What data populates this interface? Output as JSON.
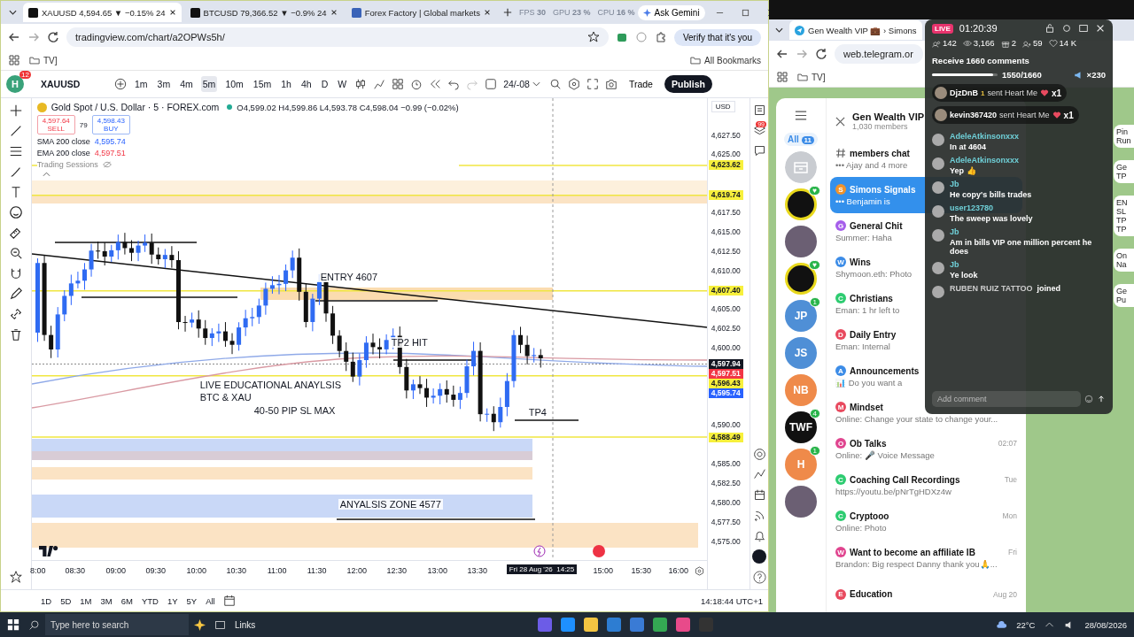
{
  "left_browser": {
    "tabs": [
      {
        "title": "XAUUSD 4,594.65 ▼ −0.15% 24",
        "selected": true
      },
      {
        "title": "BTCUSD 79,366.52 ▼ −0.9% 24",
        "selected": false
      },
      {
        "title": "Forex Factory | Global markets",
        "selected": false
      }
    ],
    "perf": [
      {
        "label": "FPS",
        "value": "30"
      },
      {
        "label": "GPU",
        "value": "23 %"
      },
      {
        "label": "CPU",
        "value": "16 %"
      }
    ],
    "ask": "Ask Gemini",
    "url": "tradingview.com/chart/a2OPWs5h/",
    "verify": "Verify that it's you",
    "bookmark_folder": "TV]",
    "all_bookmarks": "All Bookmarks"
  },
  "tv_toolbar": {
    "avatar": "H",
    "notifications": "12",
    "symbol": "XAUUSD",
    "intervals": [
      {
        "label": "1m",
        "selected": false
      },
      {
        "label": "3m",
        "selected": false
      },
      {
        "label": "4m",
        "selected": false
      },
      {
        "label": "5m",
        "selected": true
      },
      {
        "label": "10m",
        "selected": false
      },
      {
        "label": "15m",
        "selected": false
      },
      {
        "label": "1h",
        "selected": false
      },
      {
        "label": "4h",
        "selected": false
      },
      {
        "label": "D",
        "selected": false
      },
      {
        "label": "W",
        "selected": false
      }
    ],
    "date_range": "24/-08",
    "trade": "Trade",
    "publish": "Publish",
    "alerts_badge": "99"
  },
  "legend": {
    "title": "Gold Spot / U.S. Dollar · 5 · FOREX.com",
    "ohlc": "O4,599.02 H4,599.86 L4,593.78 C4,598.04 −0.99 (−0.02%)",
    "sell_price": "4,597.64",
    "sell": "SELL",
    "spread": "79",
    "buy_price": "4,598.43",
    "buy": "BUY",
    "indicators": [
      {
        "name": "SMA 200 close",
        "value": "4,595.74"
      },
      {
        "name": "EMA 200 close",
        "value": "4,597.51"
      }
    ],
    "sessions": "Trading Sessions"
  },
  "currency": "USD",
  "annotations": [
    "ENTRY 4607",
    "TP2 HIT",
    "LIVE EDUCATIONAL ANAYLSIS",
    "BTC & XAU",
    "40-50 PIP SL MAX",
    "TP4",
    "ANYALSIS ZONE 4577"
  ],
  "price_axis": [
    {
      "label": "4,627.50",
      "kind": "tick"
    },
    {
      "label": "4,625.00",
      "kind": "tick"
    },
    {
      "label": "4,623.62",
      "kind": "tag",
      "color": "#f7f03c"
    },
    {
      "label": "4,619.74",
      "kind": "tag",
      "color": "#f7f03c"
    },
    {
      "label": "4,617.50",
      "kind": "tick"
    },
    {
      "label": "4,615.00",
      "kind": "tick"
    },
    {
      "label": "4,612.50",
      "kind": "tick"
    },
    {
      "label": "4,610.00",
      "kind": "tick"
    },
    {
      "label": "4,607.40",
      "kind": "tag",
      "color": "#f7f03c"
    },
    {
      "label": "4,605.00",
      "kind": "tick"
    },
    {
      "label": "4,602.50",
      "kind": "tick"
    },
    {
      "label": "4,600.00",
      "kind": "tick"
    },
    {
      "label": "4,597.94",
      "kind": "tag",
      "color": "#131722"
    },
    {
      "label": "4,597.51",
      "kind": "tag",
      "color": "#f23645"
    },
    {
      "label": "4,596.43",
      "kind": "tag",
      "color": "#f7f03c"
    },
    {
      "label": "4,595.74",
      "kind": "tag",
      "color": "#2962ff"
    },
    {
      "label": "4,590.00",
      "kind": "tick"
    },
    {
      "label": "4,588.49",
      "kind": "tag",
      "color": "#f7f03c"
    },
    {
      "label": "4,585.00",
      "kind": "tick"
    },
    {
      "label": "4,582.50",
      "kind": "tick"
    },
    {
      "label": "4,580.00",
      "kind": "tick"
    },
    {
      "label": "4,577.50",
      "kind": "tick"
    },
    {
      "label": "4,575.00",
      "kind": "tick"
    }
  ],
  "time_axis": [
    "8:00",
    "08:30",
    "09:00",
    "09:30",
    "10:00",
    "10:30",
    "11:00",
    "11:30",
    "12:00",
    "12:30",
    "13:00",
    "13:30",
    "15:00",
    "15:30",
    "16:00"
  ],
  "crosshair": {
    "date": "Fri 28 Aug '26",
    "time": "14:25"
  },
  "ranges": [
    "1D",
    "5D",
    "1M",
    "3M",
    "6M",
    "YTD",
    "1Y",
    "5Y",
    "All"
  ],
  "clock": "14:18:44 UTC+1",
  "right_browser": {
    "tab": "Gen Wealth VIP 💼 › Simons",
    "url": "web.telegram.or",
    "bookmark_folder": "TV]"
  },
  "telegram": {
    "group": "Gen Wealth VIP",
    "members": "1,030 members",
    "folder": "All",
    "folder_count": "11",
    "avatars": [
      {
        "kind": "archive"
      },
      {
        "kind": "logo",
        "badge": "♥"
      },
      {
        "kind": "photo"
      },
      {
        "kind": "logo",
        "badge": "♥"
      },
      {
        "kind": "letters",
        "text": "JP",
        "color": "#4f8fd6",
        "badge": "1"
      },
      {
        "kind": "letters",
        "text": "JS",
        "color": "#4f8fd6"
      },
      {
        "kind": "letters",
        "text": "NB",
        "color": "#ef8a4a"
      },
      {
        "kind": "letters",
        "text": "TWF",
        "color": "#111111",
        "badge": "4"
      },
      {
        "kind": "letters",
        "text": "H",
        "color": "#ef8a4a",
        "badge": "1"
      },
      {
        "kind": "photo"
      }
    ],
    "chats": [
      {
        "kind": "topic",
        "name": "members chat",
        "preview": "••• Ajay and 4 more",
        "selected": false
      },
      {
        "kind": "chat",
        "letter": "S",
        "color": "#f0932b",
        "name": "Simons Signals",
        "preview": "••• Benjamin is",
        "selected": true
      },
      {
        "kind": "chat",
        "letter": "G",
        "color": "#a55eea",
        "name": "General Chit",
        "preview": "Summer: Haha",
        "selected": false
      },
      {
        "kind": "chat",
        "letter": "W",
        "color": "#3c8ce7",
        "name": "Wins",
        "preview": "Shymoon.eth: Photo",
        "selected": false
      },
      {
        "kind": "chat",
        "letter": "C",
        "color": "#2ecc71",
        "name": "Christians",
        "preview": "Eman: 1 hr left to",
        "selected": false
      },
      {
        "kind": "chat",
        "letter": "D",
        "color": "#e84a5f",
        "name": "Daily Entry",
        "preview": "Eman: Internal",
        "selected": false
      },
      {
        "kind": "chat",
        "letter": "A",
        "color": "#3c8ce7",
        "name": "Announcements",
        "preview": "📊 Do you want a",
        "selected": false
      },
      {
        "kind": "chat",
        "letter": "M",
        "color": "#e84a5f",
        "name": "Mindset",
        "preview": "Online: Change your state to change your...",
        "selected": false
      },
      {
        "kind": "chat",
        "letter": "O",
        "color": "#e0458f",
        "name": "Ob Talks",
        "preview": "Online: 🎤 Voice Message",
        "time": "02:07",
        "selected": false
      },
      {
        "kind": "chat",
        "letter": "C",
        "color": "#2ecc71",
        "name": "Coaching Call Recordings",
        "preview": "https://youtu.be/pNrTgHDXz4w",
        "time": "Tue",
        "selected": false
      },
      {
        "kind": "chat",
        "letter": "C",
        "color": "#2ecc71",
        "name": "Cryptooo",
        "preview": "Online: Photo",
        "time": "Mon",
        "selected": false
      },
      {
        "kind": "chat",
        "letter": "W",
        "color": "#e0458f",
        "name": "Want to become an affiliate IB",
        "preview": "Brandon: Big respect Danny thank you🙏...",
        "time": "Fri",
        "selected": false
      },
      {
        "kind": "chat",
        "letter": "E",
        "color": "#e84a5f",
        "name": "Education",
        "time": "Aug 20",
        "selected": false
      }
    ],
    "side": [
      {
        "lines": [
          "Pin",
          "Run"
        ]
      },
      {
        "lines": [
          "Ge",
          "TP"
        ]
      },
      {
        "lines": [
          "EN",
          "SL",
          "TP",
          "TP"
        ]
      },
      {
        "lines": [
          "On",
          "Na"
        ]
      },
      {
        "lines": [
          "Ge",
          "Pu"
        ]
      }
    ]
  },
  "live": {
    "badge": "LIVE",
    "timer": "01:20:39",
    "stats": [
      {
        "kind": "viewers",
        "value": "142"
      },
      {
        "kind": "views",
        "value": "3,166"
      },
      {
        "kind": "gifts",
        "value": "2"
      },
      {
        "kind": "followers",
        "value": "59"
      },
      {
        "kind": "likes",
        "value": "14 K"
      }
    ],
    "goal": "Receive 1660 comments",
    "progress": "1550/1660",
    "level": 0.934,
    "reward": "×230",
    "gifts": [
      {
        "user": "DjzDnB",
        "rank": "1",
        "text": "sent Heart Me",
        "count": "x1"
      },
      {
        "user": "kevin367420",
        "text": "sent Heart Me",
        "count": "x1"
      }
    ],
    "comments": [
      {
        "kind": "comment",
        "user": "AdeleAtkinsonxxx",
        "text": "In at 4604"
      },
      {
        "kind": "comment",
        "user": "AdeleAtkinsonxxx",
        "text": "Yep 👍"
      },
      {
        "kind": "comment",
        "user": "Jb",
        "text": "He copy's bills trades"
      },
      {
        "kind": "comment",
        "user": "user123780",
        "text": "The sweep was lovely"
      },
      {
        "kind": "comment",
        "user": "Jb",
        "text": "Am in bills VIP one million percent he does"
      },
      {
        "kind": "comment",
        "user": "Jb",
        "text": "Ye look"
      },
      {
        "kind": "join",
        "user": "RUBEN RUIZ TATTOO",
        "text": "joined"
      }
    ],
    "input": {
      "placeholder": "Add comment"
    }
  },
  "taskbar": {
    "search": {
      "placeholder": "Type here to search"
    },
    "links": "Links",
    "weather": "22°C",
    "date": "28/08/2026"
  }
}
